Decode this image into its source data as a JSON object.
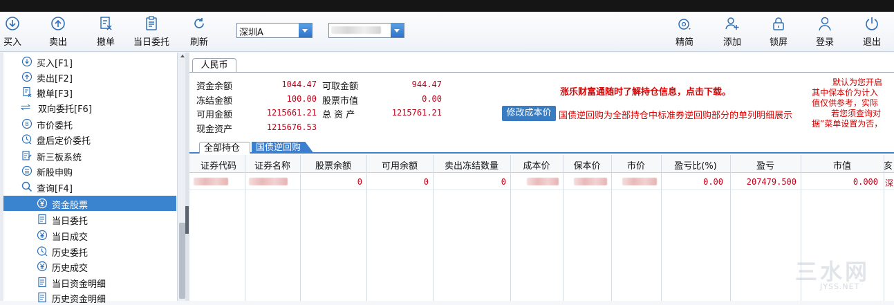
{
  "toolbar": {
    "buttons": [
      {
        "label": "买入"
      },
      {
        "label": "卖出"
      },
      {
        "label": "撤单"
      },
      {
        "label": "当日委托"
      },
      {
        "label": "刷新"
      }
    ],
    "market_select": "深圳A",
    "right_buttons": [
      {
        "label": "精简"
      },
      {
        "label": "添加"
      },
      {
        "label": "锁屏"
      },
      {
        "label": "登录"
      },
      {
        "label": "退出"
      }
    ]
  },
  "sidebar": {
    "items": [
      {
        "label": "买入[F1]",
        "icon": "buy-icon"
      },
      {
        "label": "卖出[F2]",
        "icon": "sell-icon"
      },
      {
        "label": "撤单[F3]",
        "icon": "cancel-order-icon"
      },
      {
        "label": "双向委托[F6]",
        "icon": "two-way-arrows-icon"
      },
      {
        "label": "市价委托",
        "icon": "market-order-icon"
      },
      {
        "label": "盘后定价委托",
        "icon": "clock-icon"
      },
      {
        "label": "新三板系统",
        "icon": "document-edit-icon"
      },
      {
        "label": "新股申购",
        "icon": "list-circle-icon"
      },
      {
        "label": "查询[F4]",
        "icon": "search-icon"
      },
      {
        "label": "资金股票",
        "icon": "yuan-circle-icon"
      },
      {
        "label": "当日委托",
        "icon": "document-icon"
      },
      {
        "label": "当日成交",
        "icon": "yuan-circle-icon"
      },
      {
        "label": "历史委托",
        "icon": "history-clock-icon"
      },
      {
        "label": "历史成交",
        "icon": "yuan-circle-icon"
      },
      {
        "label": "当日资金明细",
        "icon": "document-icon"
      },
      {
        "label": "历史资金明细",
        "icon": "document-icon"
      }
    ]
  },
  "currency_tab": "人民币",
  "funds": {
    "balance_label": "资金余额",
    "balance": "1044.47",
    "withdrawable_label": "可取金额",
    "withdrawable": "944.47",
    "frozen_label": "冻结金额",
    "frozen": "100.00",
    "stock_value_label": "股票市值",
    "stock_value": "0.00",
    "available_label": "可用金额",
    "available": "1215661.21",
    "total_assets_label": "总 资 产",
    "total_assets": "1215761.21",
    "cash_assets_label": "现金资产",
    "cash_assets": "1215676.53"
  },
  "promo_text": "涨乐财富通随时了解持仓信息，点击下载。",
  "modify_cost_button": "修改成本价",
  "repo_note": "国债逆回购为全部持仓中标准券逆回购部分的单列明细展示",
  "notice_lines": [
    "默认为您开启",
    "其中保本价为计入",
    "值仅供参考，实际",
    "若您须查询对",
    "据”菜单设置为否，"
  ],
  "subtabs": [
    "全部持仓",
    "国债逆回购"
  ],
  "table": {
    "columns": [
      "证券代码",
      "证券名称",
      "股票余额",
      "可用余额",
      "卖出冻结数量",
      "成本价",
      "保本价",
      "市价",
      "盈亏比(%)",
      "盈亏",
      "市值",
      "亥"
    ],
    "row": {
      "stock_balance": "0",
      "available_balance": "0",
      "sell_frozen": "0",
      "pnl_ratio": "0.00",
      "pnl": "207479.500",
      "market_value": "0.000",
      "last": "深"
    }
  },
  "watermark": {
    "text": "三水网",
    "url": "JYSS.NET"
  },
  "colors": {
    "accent": "#3a83cf",
    "value_red": "#c0001a",
    "notice_red": "#e00000"
  }
}
